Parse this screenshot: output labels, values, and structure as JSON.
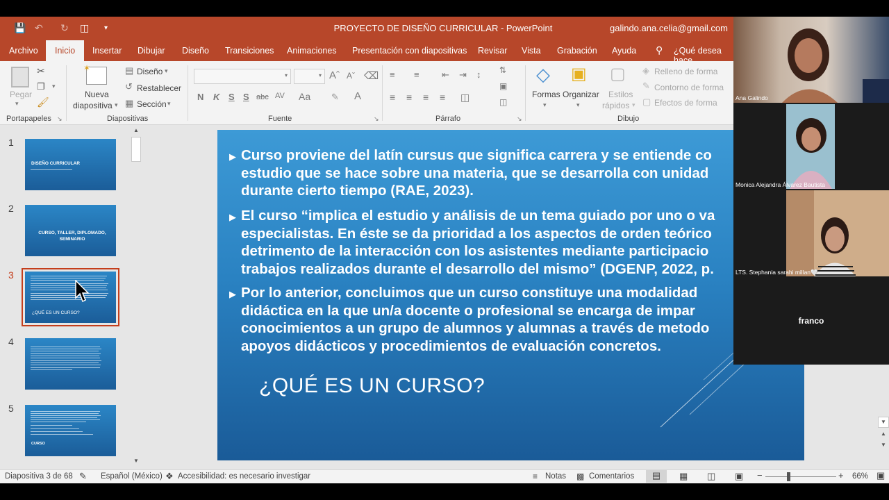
{
  "window": {
    "title": "PROYECTO DE DISEÑO CURRICULAR  -  PowerPoint",
    "account": "galindo.ana.celia@gmail.com"
  },
  "tabs": [
    "Archivo",
    "Inicio",
    "Insertar",
    "Dibujar",
    "Diseño",
    "Transiciones",
    "Animaciones",
    "Presentación con diapositivas",
    "Revisar",
    "Vista",
    "Grabación",
    "Ayuda"
  ],
  "tell_me": "¿Qué desea hace",
  "ribbon": {
    "pegar": "Pegar",
    "nueva1": "Nueva",
    "nueva2": "diapositiva",
    "diseno": "Diseño",
    "restablecer": "Restablecer",
    "seccion": "Sección",
    "formas": "Formas",
    "organizar": "Organizar",
    "estilos1": "Estilos",
    "estilos2": "rápidos",
    "relleno": "Relleno de forma",
    "contorno": "Contorno de forma",
    "efectos": "Efectos de forma",
    "fmt_n": "N",
    "fmt_k": "K",
    "fmt_s": "S",
    "fmt_abc": "abc",
    "fmt_av": "AV",
    "fmt_aa": "Aa",
    "groups": {
      "portapapeles": "Portapapeles",
      "diapositivas": "Diapositivas",
      "fuente": "Fuente",
      "parrafo": "Párrafo",
      "dibujo": "Dibujo"
    }
  },
  "thumbnails": [
    {
      "num": "1",
      "title": "DISEÑO CURRICULAR"
    },
    {
      "num": "2",
      "title": "CURSO, TALLER, DIPLOMADO, SEMINARIO"
    },
    {
      "num": "3",
      "title": "¿QUÉ ES UN CURSO?"
    },
    {
      "num": "4",
      "title": ""
    },
    {
      "num": "5",
      "title": "CURSO"
    }
  ],
  "slide": {
    "bullets": [
      [
        "Curso proviene del latín cursus que significa carrera y se entiende co",
        "estudio que se hace sobre una materia, que se desarrolla con unidad",
        "durante cierto tiempo (RAE, 2023)."
      ],
      [
        "El curso “implica el estudio y análisis de un tema guiado por uno o va",
        "especialistas. En éste se da prioridad a los aspectos de orden teórico",
        "detrimento de la interacción con los asistentes mediante participacio",
        "trabajos realizados durante el desarrollo del mismo” (DGENP, 2022, p."
      ],
      [
        "Por lo anterior, concluimos que un curso constituye una modalidad",
        "didáctica en la que un/a docente o profesional se encarga de impar",
        "conocimientos a un grupo de alumnos y alumnas a través de metodo",
        "apoyos didácticos y procedimientos de evaluación concretos."
      ]
    ],
    "title": "¿QUÉ ES UN CURSO?"
  },
  "status": {
    "slide": "Diapositiva 3 de 68",
    "language": "Español (México)",
    "accessibility": "Accesibilidad: es necesario investigar",
    "notas": "Notas",
    "comentarios": "Comentarios",
    "zoom": "66%"
  },
  "participants": [
    {
      "name": "Ana Galindo"
    },
    {
      "name": "Monica Alejandra Álvarez Bautista"
    },
    {
      "name": "LTS. Stephania sarahi millan🤍"
    },
    {
      "name": "franco"
    }
  ]
}
